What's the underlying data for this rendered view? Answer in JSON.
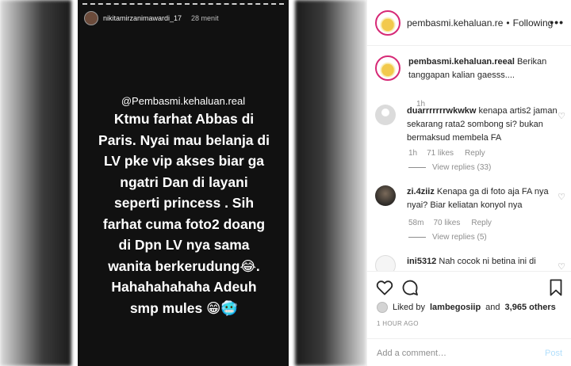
{
  "story": {
    "username": "nikitamirzanimawardi_17",
    "time": "28 menit",
    "mention": "@Pembasmi.kehaluan.real",
    "lines": [
      "Ktmu farhat Abbas di",
      "Paris. Nyai mau belanja di",
      "LV pke vip akses biar ga",
      "ngatri Dan di layani",
      "seperti princess . Sih",
      "farhat cuma foto2 doang",
      "di Dpn LV nya sama",
      "wanita berkerudung",
      "Hahahahahaha Adeuh",
      "smp mules"
    ],
    "emoji_laugh": "😂",
    "emoji_grin": "😁",
    "emoji_cold": "🥶"
  },
  "header": {
    "username": "pembasmi.kehaluan.re",
    "dot": "•",
    "follow_label": "Following",
    "more_icon": "more-dots-icon"
  },
  "caption": {
    "username": "pembasmi.kehaluan.reeal",
    "text": "Berikan tanggapan kalian gaesss....",
    "time": "1h"
  },
  "comments": [
    {
      "username": "duarrrrrrrwkwkw",
      "text": "kenapa artis2 jaman sekarang rata2 sombong si? bukan bermaksud membela FA",
      "time": "1h",
      "likes": "71 likes",
      "reply": "Reply",
      "view_replies": "View replies (33)"
    },
    {
      "username": "zi.4ziiz",
      "text": "Kenapa ga di foto aja FA nya nyai? Biar keliatan konyol nya",
      "time": "58m",
      "likes": "70 likes",
      "reply": "Reply",
      "view_replies": "View replies (5)"
    },
    {
      "username": "ini5312",
      "text": "Nah cocok ni betina ini di"
    }
  ],
  "likes": {
    "prefix": "Liked by",
    "user": "lambegosiip",
    "and": "and",
    "count": "3,965 others"
  },
  "time_ago": "1 HOUR AGO",
  "add_comment": {
    "placeholder": "Add a comment…",
    "post_label": "Post"
  }
}
